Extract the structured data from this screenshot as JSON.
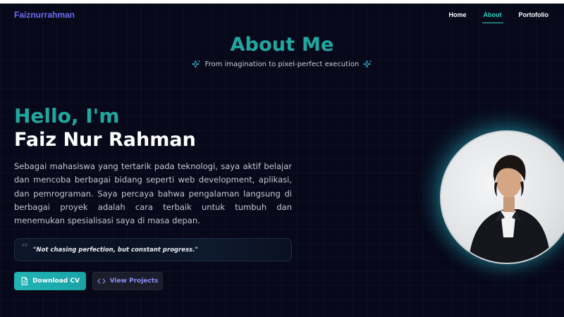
{
  "nav": {
    "brand": "Faiznurrahman",
    "links": [
      {
        "label": "Home",
        "active": false
      },
      {
        "label": "About",
        "active": true
      },
      {
        "label": "Portofolio",
        "active": false
      }
    ]
  },
  "section": {
    "title": "About Me",
    "subtitle": "From imagination to pixel-perfect execution",
    "subtitle_icon": "sparkles-icon"
  },
  "hero": {
    "greeting": "Hello, I'm",
    "name": "Faiz Nur Rahman",
    "bio": "Sebagai mahasiswa yang tertarik pada teknologi, saya aktif belajar dan mencoba berbagai bidang seperti web development, aplikasi, dan pemrograman. Saya percaya bahwa pengalaman langsung di berbagai proyek adalah cara terbaik untuk tumbuh dan menemukan spesialisasi saya di masa depan.",
    "quote": "\"Not chasing perfection, but constant progress.\""
  },
  "buttons": {
    "download_cv": {
      "label": "Download CV",
      "icon": "document-icon"
    },
    "view_projects": {
      "label": "View Projects",
      "icon": "code-icon"
    }
  },
  "colors": {
    "background": "#07081a",
    "accent_teal": "#1fa89f",
    "brand": "#6b6ef0",
    "secondary_button_text": "#8a8ef5"
  }
}
